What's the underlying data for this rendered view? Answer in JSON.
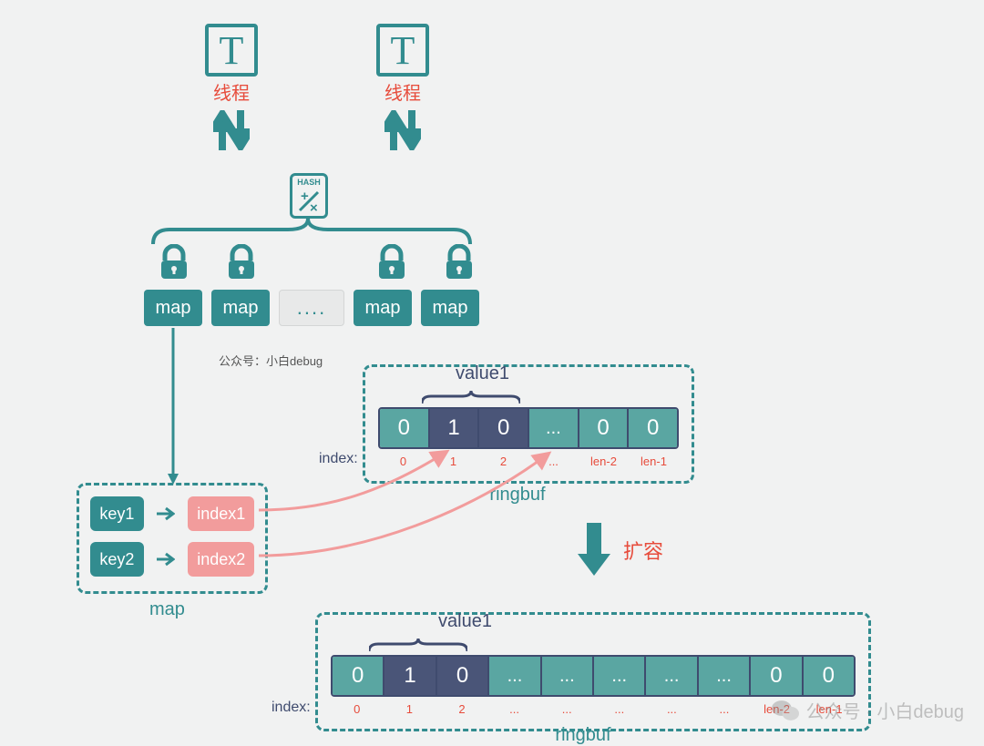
{
  "threads": {
    "glyph": "T",
    "label": "线程"
  },
  "hash_label": "HASH",
  "map_cell": "map",
  "dots": "....",
  "credit": "公众号：小白debug",
  "mapbox": {
    "keys": [
      "key1",
      "key2"
    ],
    "indexes": [
      "index1",
      "index2"
    ],
    "label": "map"
  },
  "index_label": "index:",
  "value1": "value1",
  "ringbuf_label": "ringbuf",
  "expand_label": "扩容",
  "rb1": {
    "cells": [
      "0",
      "1",
      "0",
      "...",
      "0",
      "0"
    ],
    "classes": [
      "teal-bg",
      "navy-bg",
      "navy-bg",
      "teal-bg dots",
      "teal-bg",
      "teal-bg"
    ],
    "indexes": [
      "0",
      "1",
      "2",
      "...",
      "len-2",
      "len-1"
    ]
  },
  "rb2": {
    "cells": [
      "0",
      "1",
      "0",
      "...",
      "...",
      "...",
      "...",
      "...",
      "0",
      "0"
    ],
    "classes": [
      "teal-bg",
      "navy-bg",
      "navy-bg",
      "teal-bg dots",
      "teal-bg dots",
      "teal-bg dots",
      "teal-bg dots",
      "teal-bg dots",
      "teal-bg",
      "teal-bg"
    ],
    "indexes": [
      "0",
      "1",
      "2",
      "...",
      "...",
      "...",
      "...",
      "...",
      "len-2",
      "len-1"
    ]
  },
  "watermark": "公众号 · 小白debug"
}
